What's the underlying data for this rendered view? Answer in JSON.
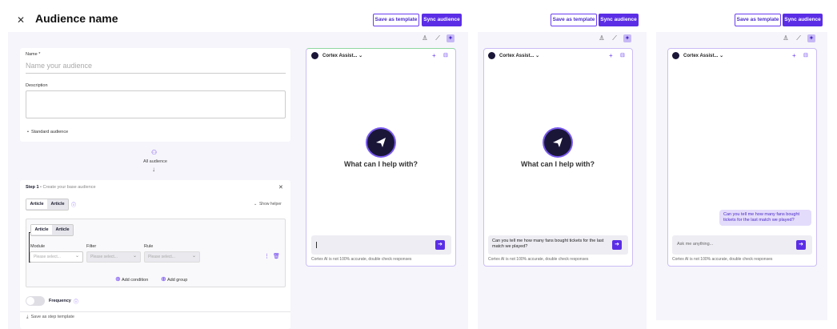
{
  "header": {
    "title": "Audience name",
    "close_icon": "close-icon"
  },
  "buttons": {
    "save_template": "Save as template",
    "sync": "Sync audience"
  },
  "form": {
    "name_label": "Name *",
    "name_placeholder": "Name your audience",
    "description_label": "Description",
    "audience_type": "Standard audience"
  },
  "flow": {
    "all_audience": "All audience"
  },
  "step": {
    "title": "Step 1",
    "subtitle": "Create your base audience",
    "tab_a": "Article",
    "tab_b": "Article",
    "show_helper": "Show helper",
    "inner_tab_a": "Article",
    "inner_tab_b": "Article",
    "module_label": "Module",
    "filter_label": "Filter",
    "rule_label": "Rule",
    "select_placeholder": "Please select...",
    "add_condition": "Add condition",
    "add_group": "Add group",
    "frequency": "Frequency",
    "save_step": "Save as step template"
  },
  "assistant": {
    "name": "Cortex Assist...",
    "prompt": "What can I help with?",
    "question": "Can you tell me how many fans bought tickets for the last match we played?",
    "input_placeholder": "Ask me anything...",
    "disclaimer": "Cortex AI is not 100% accurate, double check responses"
  },
  "colors": {
    "accent": "#5b2ee6",
    "panel": "#f6f5fb",
    "user_bubble": "#e4dcfb"
  }
}
